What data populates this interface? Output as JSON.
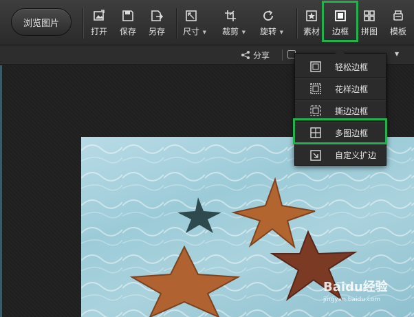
{
  "toolbar": {
    "browse_label": "浏览图片",
    "tools": [
      {
        "label": "打开",
        "icon": "open-icon"
      },
      {
        "label": "保存",
        "icon": "save-icon"
      },
      {
        "label": "另存",
        "icon": "save-as-icon"
      },
      {
        "label": "尺寸",
        "icon": "resize-icon"
      },
      {
        "label": "裁剪",
        "icon": "crop-icon"
      },
      {
        "label": "旋转",
        "icon": "rotate-icon"
      },
      {
        "label": "素材",
        "icon": "material-icon"
      },
      {
        "label": "边框",
        "icon": "border-icon"
      },
      {
        "label": "拼图",
        "icon": "collage-icon"
      },
      {
        "label": "模板",
        "icon": "template-icon"
      }
    ]
  },
  "subbar": {
    "share_label": "分享"
  },
  "border_menu": {
    "items": [
      {
        "label": "轻松边框",
        "icon": "simple-border-icon"
      },
      {
        "label": "花样边框",
        "icon": "pattern-border-icon"
      },
      {
        "label": "撕边边框",
        "icon": "torn-border-icon"
      },
      {
        "label": "多图边框",
        "icon": "multi-image-border-icon"
      },
      {
        "label": "自定义扩边",
        "icon": "custom-expand-icon"
      }
    ]
  },
  "watermark": {
    "main": "Baidu经验",
    "sub": "jingyan.baidu.com"
  },
  "colors": {
    "highlight": "#22b14c",
    "toolbar_bg": "#333333",
    "menu_bg": "#2b2b2b"
  }
}
